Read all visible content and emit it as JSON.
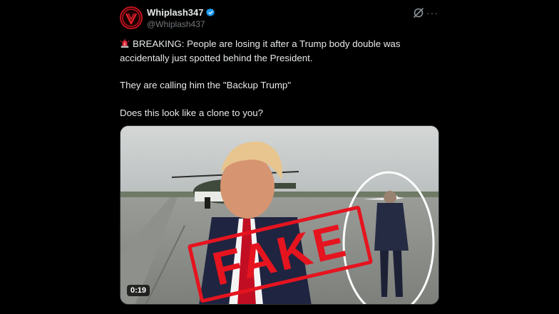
{
  "author": {
    "display_name": "Whiplash347",
    "handle": "@Whiplash437",
    "verified_icon": "verified-badge-icon",
    "avatar_icon": "whiplash-logo-icon"
  },
  "actions": {
    "grok_icon": "grok-icon",
    "more_label": "···"
  },
  "post": {
    "line1": "BREAKING: People are losing it after a Trump body double was accidentally just spotted behind the President.",
    "line2": "They are calling him the \"Backup Trump\"",
    "line3": "Does this look like a clone to you?",
    "siren_icon": "rotating-light-icon"
  },
  "media": {
    "stamp_text": "FAKE",
    "duration": "0:19",
    "stamp_color": "#e5141f"
  },
  "colors": {
    "background": "#000000",
    "text": "#e7e9ea",
    "muted": "#71767b",
    "verified": "#1d9bf0"
  }
}
